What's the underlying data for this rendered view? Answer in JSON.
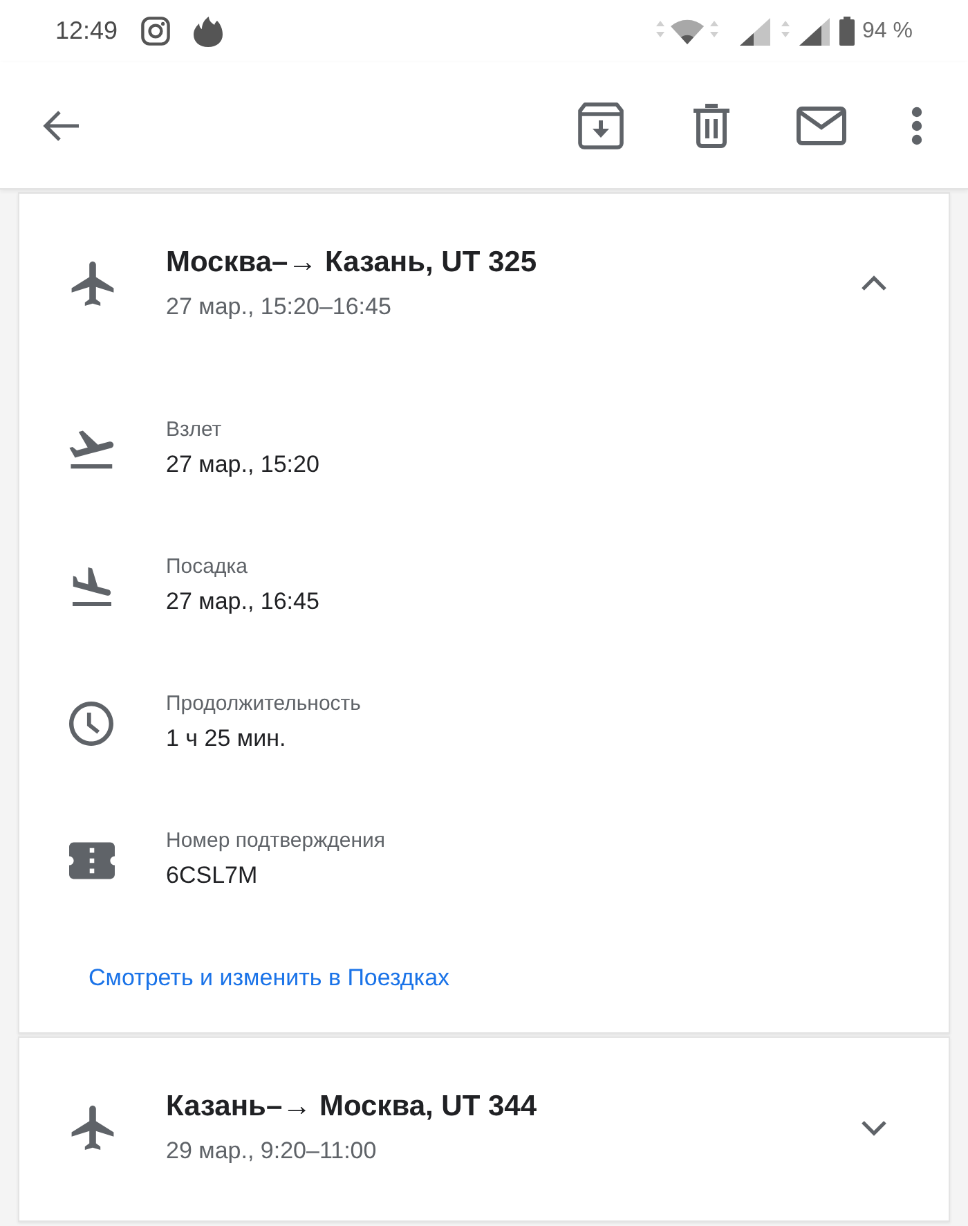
{
  "status_bar": {
    "time": "12:49",
    "battery": "94 %"
  },
  "flights": [
    {
      "title": "Москва–→ Казань, UT 325",
      "subtitle": "27 мар., 15:20–16:45",
      "expanded": true,
      "details": [
        {
          "kind": "takeoff",
          "label": "Взлет",
          "value": "27 мар., 15:20"
        },
        {
          "kind": "landing",
          "label": "Посадка",
          "value": "27 мар., 16:45"
        },
        {
          "kind": "duration",
          "label": "Продолжительность",
          "value": "1 ч 25 мин."
        },
        {
          "kind": "confirmation",
          "label": "Номер подтверждения",
          "value": "6CSL7M"
        }
      ],
      "link": "Смотреть и изменить в Поездках"
    },
    {
      "title": "Казань–→ Москва, UT 344",
      "subtitle": "29 мар., 9:20–11:00",
      "expanded": false
    }
  ]
}
